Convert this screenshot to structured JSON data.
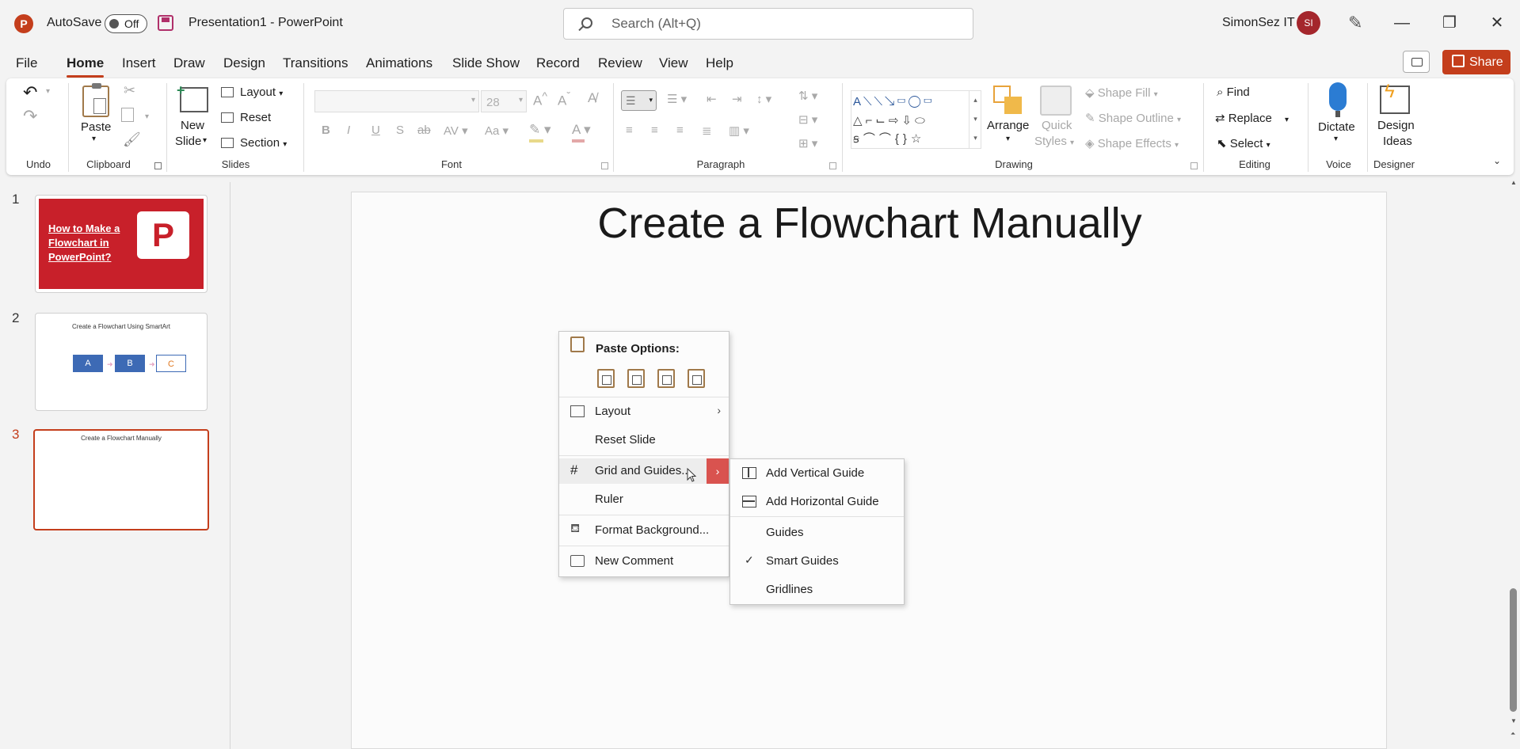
{
  "titlebar": {
    "logo": "P",
    "autosave_label": "AutoSave",
    "autosave_state": "Off",
    "document_title": "Presentation1  -  PowerPoint",
    "search_placeholder": "Search (Alt+Q)",
    "user_name": "SimonSez IT",
    "avatar_initials": "SI",
    "icons": [
      "powerpoint-logo-icon",
      "save-icon",
      "search-icon",
      "pen-icon",
      "minimize-icon",
      "restore-icon",
      "close-icon"
    ]
  },
  "menu": {
    "tabs": [
      "File",
      "Home",
      "Insert",
      "Draw",
      "Design",
      "Transitions",
      "Animations",
      "Slide Show",
      "Record",
      "Review",
      "View",
      "Help"
    ],
    "active_tab": "Home",
    "share_label": "Share"
  },
  "ribbon": {
    "groups": {
      "undo": "Undo",
      "clipboard": "Clipboard",
      "slides": "Slides",
      "font": "Font",
      "paragraph": "Paragraph",
      "drawing": "Drawing",
      "editing": "Editing",
      "voice": "Voice",
      "designer": "Designer"
    },
    "paste_label": "Paste",
    "new_slide_label_1": "New",
    "new_slide_label_2": "Slide",
    "layout_label": "Layout",
    "reset_label": "Reset",
    "section_label": "Section",
    "font_size": "28",
    "arrange_label": "Arrange",
    "quick_styles_1": "Quick",
    "quick_styles_2": "Styles",
    "shape_fill": "Shape Fill",
    "shape_outline": "Shape Outline",
    "shape_effects": "Shape Effects",
    "find_label": "Find",
    "replace_label": "Replace",
    "select_label": "Select",
    "dictate_label": "Dictate",
    "design_ideas_1": "Design",
    "design_ideas_2": "Ideas"
  },
  "slides_panel": {
    "slides": [
      {
        "number": "1",
        "title": "How to Make a Flowchart in PowerPoint?"
      },
      {
        "number": "2",
        "title": "Create a Flowchart Using SmartArt",
        "nodes": [
          "A",
          "B",
          "C"
        ]
      },
      {
        "number": "3",
        "title": "Create a Flowchart Manually"
      }
    ],
    "selected": "3"
  },
  "slide": {
    "title": "Create a Flowchart Manually"
  },
  "context_menu": {
    "paste_options_label": "Paste Options:",
    "items": [
      "Layout",
      "Reset Slide",
      "Grid and Guides...",
      "Ruler",
      "Format Background...",
      "New Comment"
    ]
  },
  "submenu": {
    "items": [
      "Add Vertical Guide",
      "Add Horizontal Guide",
      "Guides",
      "Smart Guides",
      "Gridlines"
    ],
    "checked": "Smart Guides"
  },
  "colors": {
    "accent": "#c43e1c",
    "submenu_highlight": "#d9534f",
    "slide1_bg": "#c8202a",
    "node_blue": "#3d6ab5"
  }
}
